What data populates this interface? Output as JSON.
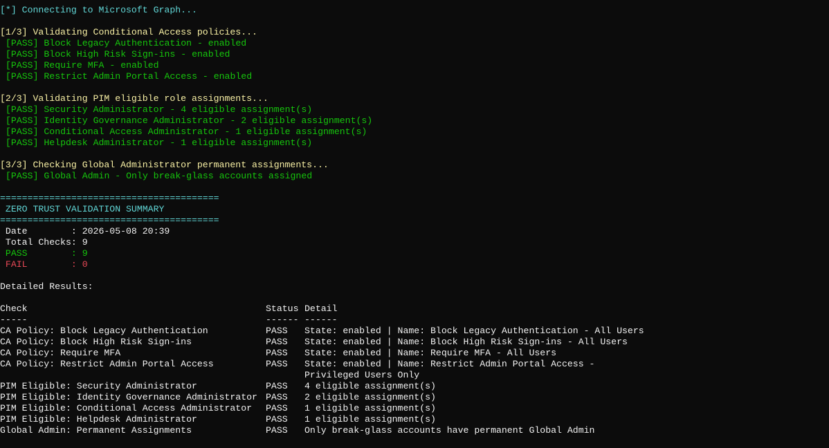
{
  "colors": {
    "background": "#0c0c0c",
    "default_text": "#cccccc",
    "cyan": "#61d6d6",
    "yellow": "#f9f1a5",
    "green": "#16c60c",
    "red": "#e74856",
    "white": "#f2f2f2"
  },
  "connect_line": "[*] Connecting to Microsoft Graph...",
  "step1": {
    "header": "[1/3] Validating Conditional Access policies...",
    "results": [
      "[PASS] Block Legacy Authentication - enabled",
      "[PASS] Block High Risk Sign-ins - enabled",
      "[PASS] Require MFA - enabled",
      "[PASS] Restrict Admin Portal Access - enabled"
    ]
  },
  "step2": {
    "header": "[2/3] Validating PIM eligible role assignments...",
    "results": [
      "[PASS] Security Administrator - 4 eligible assignment(s)",
      "[PASS] Identity Governance Administrator - 2 eligible assignment(s)",
      "[PASS] Conditional Access Administrator - 1 eligible assignment(s)",
      "[PASS] Helpdesk Administrator - 1 eligible assignment(s)"
    ]
  },
  "step3": {
    "header": "[3/3] Checking Global Administrator permanent assignments...",
    "results": [
      "[PASS] Global Admin - Only break-glass accounts assigned"
    ]
  },
  "summary": {
    "rule": "========================================",
    "title": " ZERO TRUST VALIDATION SUMMARY",
    "date": " Date        : 2026-05-08 20:39",
    "total": " Total Checks: 9",
    "pass": " PASS        : 9",
    "fail": " FAIL        : 0"
  },
  "detailed": {
    "heading": "Detailed Results:",
    "headers": {
      "check": "Check",
      "status": "Status",
      "detail": "Detail"
    },
    "underline": {
      "check": "-----",
      "status": "------",
      "detail": "------"
    },
    "rows": [
      {
        "check": "CA Policy: Block Legacy Authentication",
        "status": "PASS",
        "detail": "State: enabled | Name: Block Legacy Authentication - All Users"
      },
      {
        "check": "CA Policy: Block High Risk Sign-ins",
        "status": "PASS",
        "detail": "State: enabled | Name: Block High Risk Sign-ins - All Users"
      },
      {
        "check": "CA Policy: Require MFA",
        "status": "PASS",
        "detail": "State: enabled | Name: Require MFA - All Users"
      },
      {
        "check": "CA Policy: Restrict Admin Portal Access",
        "status": "PASS",
        "detail": "State: enabled | Name: Restrict Admin Portal Access -"
      },
      {
        "check": "",
        "status": "",
        "detail": "Privileged Users Only"
      },
      {
        "check": "PIM Eligible: Security Administrator",
        "status": "PASS",
        "detail": "4 eligible assignment(s)"
      },
      {
        "check": "PIM Eligible: Identity Governance Administrator",
        "status": "PASS",
        "detail": "2 eligible assignment(s)"
      },
      {
        "check": "PIM Eligible: Conditional Access Administrator",
        "status": "PASS",
        "detail": "1 eligible assignment(s)"
      },
      {
        "check": "PIM Eligible: Helpdesk Administrator",
        "status": "PASS",
        "detail": "1 eligible assignment(s)"
      },
      {
        "check": "Global Admin: Permanent Assignments",
        "status": "PASS",
        "detail": "Only break-glass accounts have permanent Global Admin"
      }
    ]
  }
}
